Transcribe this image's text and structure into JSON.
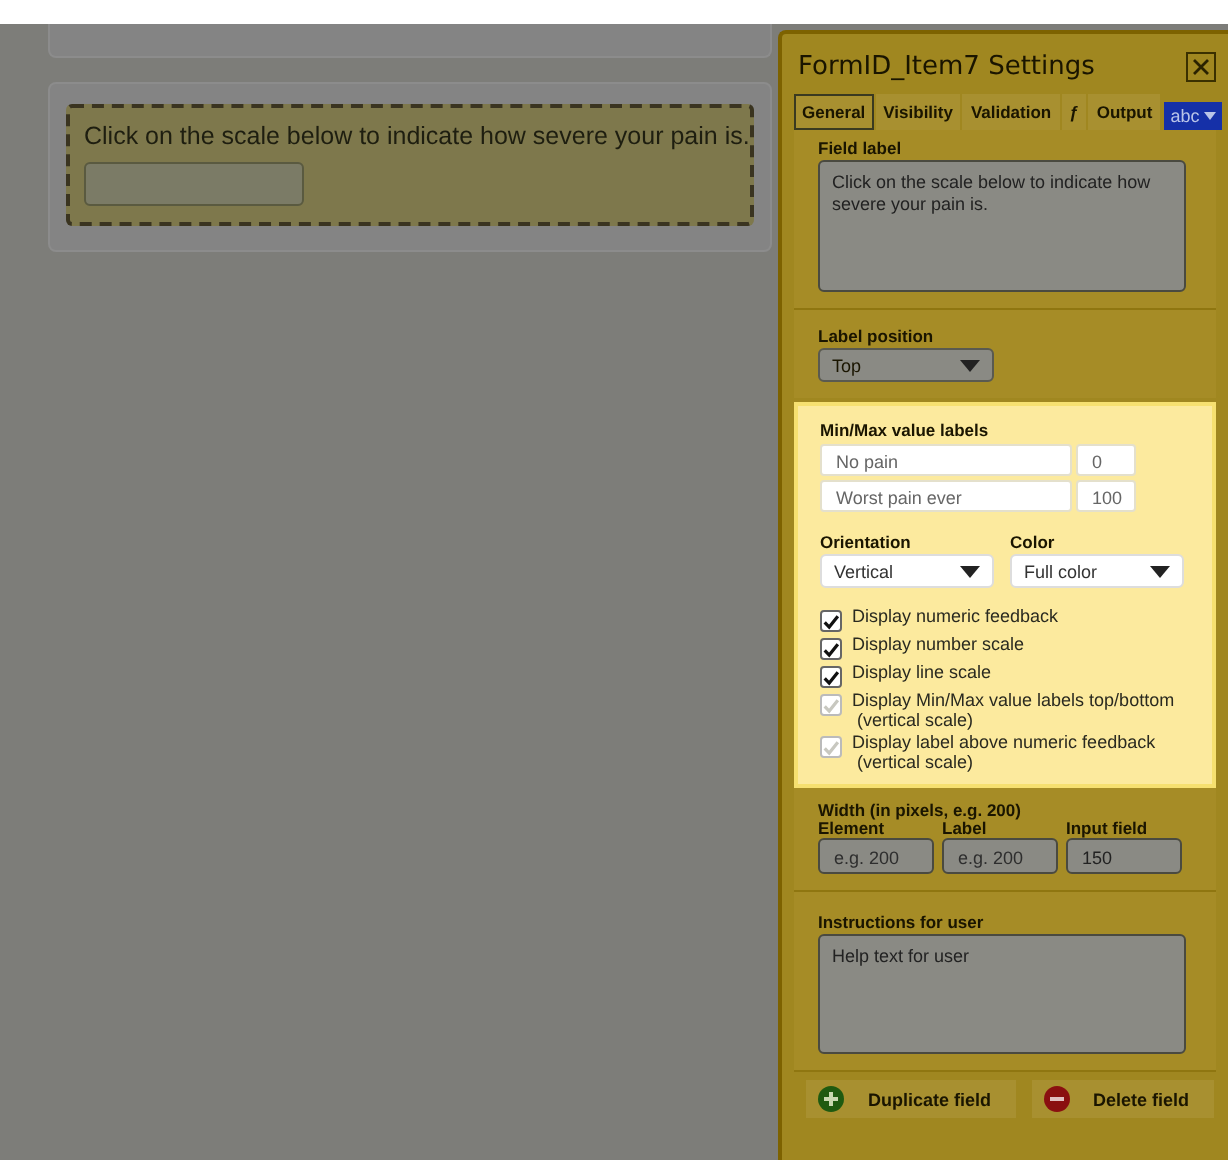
{
  "form": {
    "question": "Click on the scale below to indicate how severe your pain is."
  },
  "panel": {
    "title": "FormID_Item7 Settings",
    "tabs": [
      {
        "label": "General",
        "selected": true
      },
      {
        "label": "Visibility",
        "selected": false
      },
      {
        "label": "Validation",
        "selected": false
      },
      {
        "label": "ƒ",
        "selected": false
      },
      {
        "label": "Output",
        "selected": false
      }
    ],
    "language": "abc",
    "field_label": {
      "label": "Field label",
      "value": "Click on the scale below to indicate how severe your pain is."
    },
    "label_position": {
      "label": "Label position",
      "value": "Top"
    },
    "minmax": {
      "title": "Min/Max value labels",
      "rows": [
        {
          "label": "No pain",
          "value": "0"
        },
        {
          "label": "Worst pain ever",
          "value": "100"
        }
      ]
    },
    "orientation": {
      "label": "Orientation",
      "value": "Vertical"
    },
    "color": {
      "label": "Color",
      "value": "Full color"
    },
    "options": [
      {
        "label": "Display numeric feedback",
        "checked": true,
        "disabled": false
      },
      {
        "label": "Display number scale",
        "checked": true,
        "disabled": false
      },
      {
        "label": "Display line scale",
        "checked": true,
        "disabled": false
      },
      {
        "label": "Display Min/Max value labels top/bottom",
        "note": "(vertical scale)",
        "checked": true,
        "disabled": true
      },
      {
        "label": "Display label above numeric feedback",
        "note": "(vertical scale)",
        "checked": true,
        "disabled": true
      }
    ],
    "width": {
      "title": "Width (in pixels, e.g. 200)",
      "fields": [
        {
          "label": "Element",
          "placeholder": "e.g. 200"
        },
        {
          "label": "Label",
          "placeholder": "e.g. 200"
        },
        {
          "label": "Input field",
          "value": "150"
        }
      ]
    },
    "instructions": {
      "label": "Instructions for user",
      "value": "Help text for user"
    },
    "actions": [
      {
        "label": "Duplicate field",
        "kind": "add"
      },
      {
        "label": "Delete field",
        "kind": "remove"
      }
    ]
  }
}
